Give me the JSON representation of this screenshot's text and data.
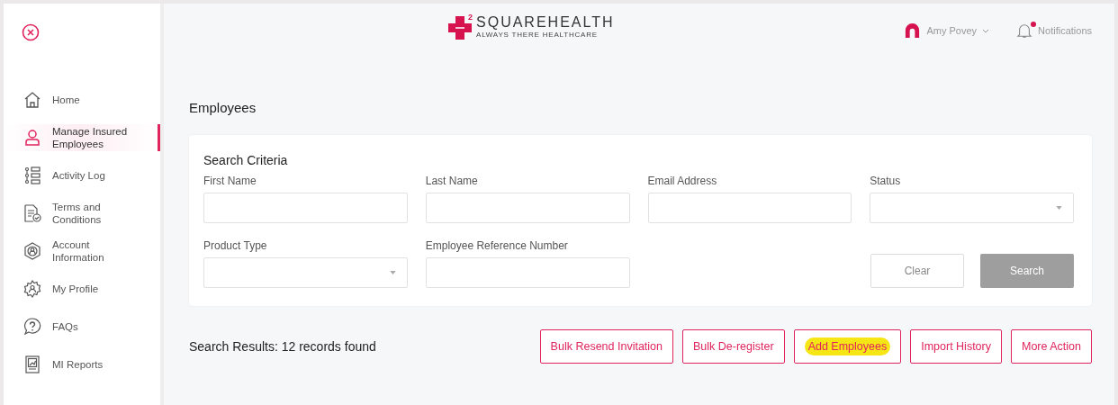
{
  "sidebar": {
    "items": [
      {
        "label": "Home",
        "kind": "home",
        "selected": false
      },
      {
        "label": "Manage Insured Employees",
        "kind": "user",
        "selected": true
      },
      {
        "label": "Activity Log",
        "kind": "log",
        "selected": false
      },
      {
        "label": "Terms and Conditions",
        "kind": "doc",
        "selected": false
      },
      {
        "label": "Account Information",
        "kind": "account",
        "selected": false
      },
      {
        "label": "My Profile",
        "kind": "profile",
        "selected": false
      },
      {
        "label": "FAQs",
        "kind": "faq",
        "selected": false
      },
      {
        "label": "MI Reports",
        "kind": "report",
        "selected": false
      }
    ]
  },
  "header": {
    "logo": {
      "sup": "2",
      "name": "**SQUARE**HEALTH",
      "tagline": "ALWAYS THERE HEALTHCARE"
    },
    "user": "Amy Povey",
    "notifications": {
      "label": "Notifications",
      "unread": true
    }
  },
  "page_title": "Employees",
  "search": {
    "title": "Search Criteria",
    "fields": [
      {
        "label": "First Name",
        "kind": "text"
      },
      {
        "label": "Last Name",
        "kind": "text"
      },
      {
        "label": "Email Address",
        "kind": "text"
      },
      {
        "label": "Status",
        "kind": "select"
      },
      {
        "label": "Product Type",
        "kind": "select"
      },
      {
        "label": "Employee Reference Number",
        "kind": "text"
      }
    ],
    "buttons": [
      {
        "label": "Clear",
        "kind": "secondary",
        "disabled": false
      },
      {
        "label": "Search",
        "kind": "primary",
        "disabled": true
      }
    ]
  },
  "results": {
    "summary": "Search Results: 12 records found",
    "actions": [
      {
        "label": "Bulk Resend Invitation",
        "highlighted": false
      },
      {
        "label": "Bulk De-register",
        "highlighted": false
      },
      {
        "label": "Add Employees",
        "highlighted": true
      },
      {
        "label": "Import History",
        "highlighted": false
      },
      {
        "label": "More Action",
        "highlighted": false
      }
    ]
  }
}
